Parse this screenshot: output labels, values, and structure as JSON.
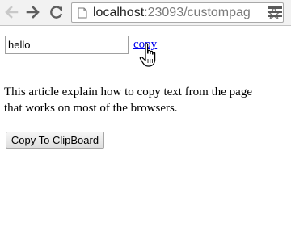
{
  "browser": {
    "url_host": "localhost",
    "url_rest": ":23093/custompag",
    "icons": [
      "back-arrow-icon",
      "forward-arrow-icon",
      "reload-icon",
      "page-icon",
      "star-icon",
      "menu-icon"
    ]
  },
  "page": {
    "input_value": "hello",
    "copy_link_label": "copy",
    "article_text": "This article explain how to copy text from the page that works on most of the browsers.",
    "clipboard_button_label": "Copy To ClipBoard"
  },
  "colors": {
    "link": "#0000ee",
    "toolbar": "#f2f2f2"
  }
}
